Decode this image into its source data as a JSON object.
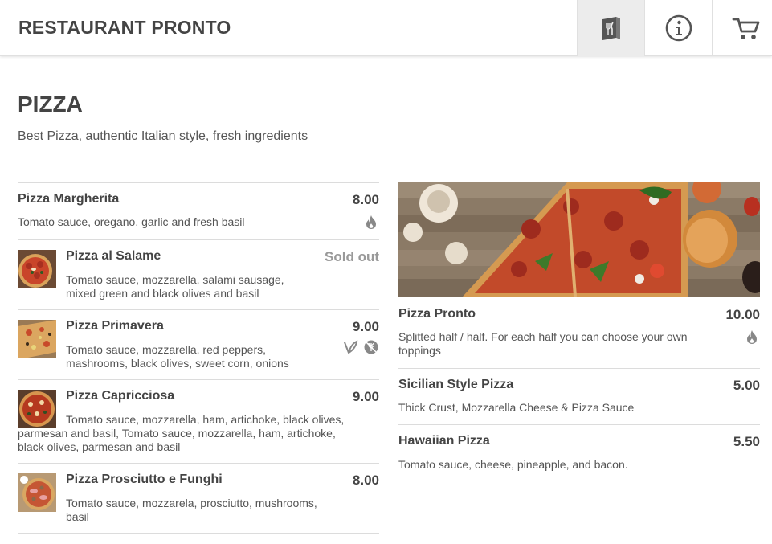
{
  "app": {
    "title": "RESTAURANT PRONTO"
  },
  "nav": [
    {
      "name": "menu",
      "icon": "menu-book-icon",
      "active": true
    },
    {
      "name": "info",
      "icon": "info-icon",
      "active": false
    },
    {
      "name": "cart",
      "icon": "cart-icon",
      "active": false
    }
  ],
  "category": {
    "title": "PIZZA",
    "subtitle": "Best Pizza, authentic Italian style, fresh ingredients"
  },
  "left_items": [
    {
      "name": "Pizza Margherita",
      "price": "8.00",
      "description": "Tomato sauce, oregano, garlic and fresh basil",
      "flags": [
        "spicy-icon"
      ]
    },
    {
      "name": "Pizza al Salame",
      "price": "Sold out",
      "description": "Tomato sauce, mozzarella, salami sausage, mixed green and black olives and basil",
      "flags": []
    },
    {
      "name": "Pizza Primavera",
      "price": "9.00",
      "description": "Tomato sauce, mozzarella, red peppers, mashrooms, black olives, sweet corn, onions",
      "flags": [
        "vegetarian-icon",
        "gluten-free-icon"
      ]
    },
    {
      "name": "Pizza Capricciosa",
      "price": "9.00",
      "description": "Tomato sauce, mozzarella, ham, artichoke, black olives, parmesan and basil, Tomato sauce, mozzarella, ham, artichoke, black olives, parmesan and basil",
      "flags": []
    },
    {
      "name": "Pizza Prosciutto e Funghi",
      "price": "8.00",
      "description": "Tomato sauce, mozzarela, prosciutto, mushrooms, basil",
      "flags": []
    }
  ],
  "right_items": [
    {
      "name": "Pizza Pronto",
      "price": "10.00",
      "description": "Splitted half / half. For each half you can choose your own toppings",
      "flags": [
        "spicy-icon"
      ]
    },
    {
      "name": "Sicilian Style Pizza",
      "price": "5.00",
      "description": "Thick Crust, Mozzarella Cheese & Pizza Sauce",
      "flags": []
    },
    {
      "name": "Hawaiian Pizza",
      "price": "5.50",
      "description": "Tomato sauce, cheese, pineapple, and bacon.",
      "flags": []
    }
  ],
  "colors": {
    "text": "#444444",
    "muted": "#999999",
    "border": "#dcdcdc",
    "active_tab": "#ececec"
  }
}
